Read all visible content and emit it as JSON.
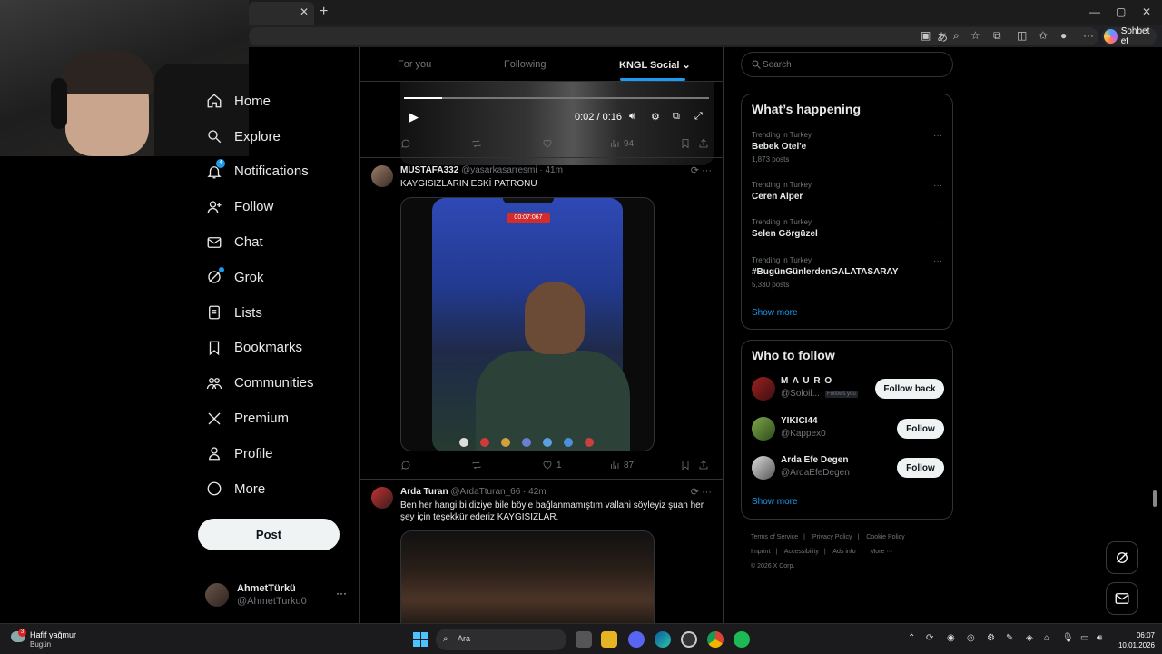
{
  "browser": {
    "tab_close": "✕",
    "new_tab": "+",
    "chat_button_label": "Sohbet et",
    "window_controls": [
      "—",
      "▢",
      "✕"
    ]
  },
  "nav": {
    "items": [
      {
        "label": "Home",
        "icon": "home-icon"
      },
      {
        "label": "Explore",
        "icon": "search-icon"
      },
      {
        "label": "Notifications",
        "icon": "bell-icon",
        "badge": "4"
      },
      {
        "label": "Follow",
        "icon": "person-plus-icon"
      },
      {
        "label": "Chat",
        "icon": "mail-icon"
      },
      {
        "label": "Grok",
        "icon": "grok-icon"
      },
      {
        "label": "Lists",
        "icon": "list-icon"
      },
      {
        "label": "Bookmarks",
        "icon": "bookmark-icon"
      },
      {
        "label": "Communities",
        "icon": "communities-icon"
      },
      {
        "label": "Premium",
        "icon": "x-logo-icon"
      },
      {
        "label": "Profile",
        "icon": "person-icon"
      },
      {
        "label": "More",
        "icon": "more-circle-icon"
      }
    ],
    "post_button": "Post",
    "account": {
      "name": "AhmetTürkü",
      "handle": "@AhmetTurku0",
      "more": "···"
    }
  },
  "feed": {
    "tabs": [
      "For you",
      "Following",
      "KNGL Social"
    ],
    "active_tab": "KNGL Social",
    "video1": {
      "time": "0:02 / 0:16",
      "progress": 0.125,
      "views": "94"
    },
    "post2": {
      "author": "MUSTAFA332",
      "handle": "@yasarkasarresmi",
      "time": "· 41m",
      "text": "KAYGISIZLARIN ESKİ PATRONU",
      "rec_label": "00:07:067",
      "likes": "1",
      "views": "87"
    },
    "post3": {
      "author": "Arda Turan",
      "handle": "@ArdaTturan_66",
      "time": "· 42m",
      "text": "Ben her hangi bi diziye bile böyle bağlanmamıştım vallahi söyleyiz şuan her şey için teşekkür ederiz KAYGISIZLAR."
    }
  },
  "sidebar": {
    "search_placeholder": "Search",
    "happening_title": "What’s happening",
    "trends": [
      {
        "context": "Trending in Turkey",
        "name": "Bebek Otel'e",
        "count": "1,873 posts"
      },
      {
        "context": "Trending in Turkey",
        "name": "Ceren Alper",
        "count": ""
      },
      {
        "context": "Trending in Turkey",
        "name": "Selen Görgüzel",
        "count": ""
      },
      {
        "context": "Trending in Turkey",
        "name": "#BugünGünlerdenGALATASARAY",
        "count": "5,330 posts"
      }
    ],
    "show_more": "Show more",
    "who_to_follow_title": "Who to follow",
    "follow_suggestions": [
      {
        "name": "M A U R O",
        "handle": "@Soloil...",
        "badge": "Follows you",
        "button": "Follow back"
      },
      {
        "name": "YIKICI44",
        "handle": "@Kappex0",
        "badge": "",
        "button": "Follow"
      },
      {
        "name": "Arda Efe Degen",
        "handle": "@ArdaEfeDegen",
        "badge": "",
        "button": "Follow"
      }
    ],
    "footer_links": [
      "Terms of Service",
      "|",
      "Privacy Policy",
      "|",
      "Cookie Policy",
      "|",
      "Imprint",
      "|",
      "Accessibility",
      "|",
      "Ads info",
      "|",
      "More ···"
    ],
    "copyright": "© 2026 X Corp."
  },
  "taskbar": {
    "weather": "Hafif yağmur",
    "weather_sub": "Bugün",
    "weather_badge": "3",
    "search_placeholder": "Ara",
    "time": "06:07",
    "date": "10.01.2026"
  }
}
